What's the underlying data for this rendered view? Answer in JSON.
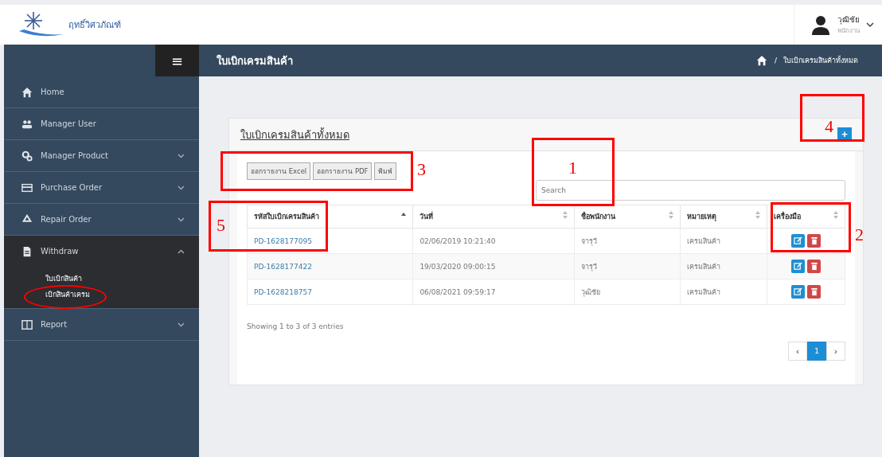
{
  "brand": {
    "name": "ฤทธิ์วิศวภัณฑ์"
  },
  "user": {
    "name": "วุฒิชัย",
    "role": "พนักงาน"
  },
  "sidebar": {
    "toggle": "≡",
    "items": [
      {
        "label": "Home"
      },
      {
        "label": "Manager User"
      },
      {
        "label": "Manager Product",
        "expanded": false
      },
      {
        "label": "Purchase Order",
        "expanded": false
      },
      {
        "label": "Repair Order",
        "expanded": false
      },
      {
        "label": "Withdraw",
        "expanded": true,
        "children": [
          {
            "label": "ใบเบิกสินค้า"
          },
          {
            "label": "เบิกสินค้าเครม"
          }
        ]
      },
      {
        "label": "Report",
        "expanded": false
      }
    ]
  },
  "header": {
    "title": "ใบเบิกเครมสินค้า",
    "separator": "/",
    "breadcrumb": "ใบเบิกเครมสินค้าทั้งหมด"
  },
  "card": {
    "title": "ใบเบิกเครมสินค้าทั้งหมด",
    "add_button": "+",
    "export_buttons": [
      "ออกรายงาน Excel",
      "ออกรายงาน PDF",
      "พิมพ์"
    ],
    "search": {
      "placeholder": "Search"
    },
    "table": {
      "columns": [
        {
          "label": "รหัสใบเบิกเครมสินค้า",
          "sorted": true
        },
        {
          "label": "วันที่",
          "sorted": false
        },
        {
          "label": "ชื่อพนักงาน",
          "sorted": false
        },
        {
          "label": "หมายเหตุ",
          "sorted": false
        },
        {
          "label": "เครื่องมือ",
          "sorted": false
        }
      ],
      "rows": [
        {
          "id": "PD-1628177095",
          "date": "02/06/2019 10:21:40",
          "employee": "จารุวี",
          "note": "เครมสินค้า"
        },
        {
          "id": "PD-1628177422",
          "date": "19/03/2020 09:00:15",
          "employee": "จารุวี",
          "note": "เครมสินค้า"
        },
        {
          "id": "PD-1628218757",
          "date": "06/08/2021 09:59:17",
          "employee": "วุฒิชัย",
          "note": "เครมสินค้า"
        }
      ]
    },
    "info": "Showing 1 to 3 of 3 entries",
    "pagination": {
      "prev": "‹",
      "pages": [
        {
          "label": "1",
          "selected": true
        }
      ],
      "next": "›"
    }
  },
  "annotations": [
    {
      "kind": "box",
      "label": "1"
    },
    {
      "kind": "box",
      "label": "2"
    },
    {
      "kind": "box",
      "label": "3"
    },
    {
      "kind": "box",
      "label": "4"
    },
    {
      "kind": "box",
      "label": "5"
    },
    {
      "kind": "ellipse"
    }
  ]
}
